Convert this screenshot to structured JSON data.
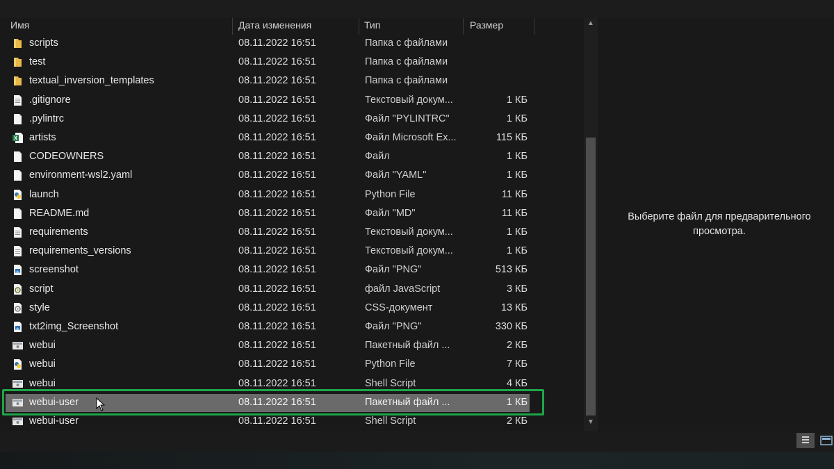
{
  "columns": {
    "name": "Имя",
    "date": "Дата изменения",
    "type": "Тип",
    "size": "Размер"
  },
  "files": [
    {
      "name": "scripts",
      "date": "08.11.2022 16:51",
      "type": "Папка с файлами",
      "size": "",
      "icon": "folder-icon"
    },
    {
      "name": "test",
      "date": "08.11.2022 16:51",
      "type": "Папка с файлами",
      "size": "",
      "icon": "folder-icon"
    },
    {
      "name": "textual_inversion_templates",
      "date": "08.11.2022 16:51",
      "type": "Папка с файлами",
      "size": "",
      "icon": "folder-icon"
    },
    {
      "name": ".gitignore",
      "date": "08.11.2022 16:51",
      "type": "Текстовый докум...",
      "size": "1 КБ",
      "icon": "text-file-icon"
    },
    {
      "name": ".pylintrc",
      "date": "08.11.2022 16:51",
      "type": "Файл \"PYLINTRC\"",
      "size": "1 КБ",
      "icon": "file-icon"
    },
    {
      "name": "artists",
      "date": "08.11.2022 16:51",
      "type": "Файл Microsoft Ex...",
      "size": "115 КБ",
      "icon": "excel-file-icon"
    },
    {
      "name": "CODEOWNERS",
      "date": "08.11.2022 16:51",
      "type": "Файл",
      "size": "1 КБ",
      "icon": "file-icon"
    },
    {
      "name": "environment-wsl2.yaml",
      "date": "08.11.2022 16:51",
      "type": "Файл \"YAML\"",
      "size": "1 КБ",
      "icon": "file-icon"
    },
    {
      "name": "launch",
      "date": "08.11.2022 16:51",
      "type": "Python File",
      "size": "11 КБ",
      "icon": "python-file-icon"
    },
    {
      "name": "README.md",
      "date": "08.11.2022 16:51",
      "type": "Файл \"MD\"",
      "size": "11 КБ",
      "icon": "file-icon"
    },
    {
      "name": "requirements",
      "date": "08.11.2022 16:51",
      "type": "Текстовый докум...",
      "size": "1 КБ",
      "icon": "text-file-icon"
    },
    {
      "name": "requirements_versions",
      "date": "08.11.2022 16:51",
      "type": "Текстовый докум...",
      "size": "1 КБ",
      "icon": "text-file-icon"
    },
    {
      "name": "screenshot",
      "date": "08.11.2022 16:51",
      "type": "Файл \"PNG\"",
      "size": "513 КБ",
      "icon": "image-file-icon"
    },
    {
      "name": "script",
      "date": "08.11.2022 16:51",
      "type": "файл JavaScript",
      "size": "3 КБ",
      "icon": "script-file-icon"
    },
    {
      "name": "style",
      "date": "08.11.2022 16:51",
      "type": "CSS-документ",
      "size": "13 КБ",
      "icon": "css-file-icon"
    },
    {
      "name": "txt2img_Screenshot",
      "date": "08.11.2022 16:51",
      "type": "Файл \"PNG\"",
      "size": "330 КБ",
      "icon": "image-file-icon"
    },
    {
      "name": "webui",
      "date": "08.11.2022 16:51",
      "type": "Пакетный файл ...",
      "size": "2 КБ",
      "icon": "batch-file-icon"
    },
    {
      "name": "webui",
      "date": "08.11.2022 16:51",
      "type": "Python File",
      "size": "7 КБ",
      "icon": "python-file-icon"
    },
    {
      "name": "webui",
      "date": "08.11.2022 16:51",
      "type": "Shell Script",
      "size": "4 КБ",
      "icon": "batch-file-icon"
    },
    {
      "name": "webui-user",
      "date": "08.11.2022 16:51",
      "type": "Пакетный файл ...",
      "size": "1 КБ",
      "icon": "batch-file-icon",
      "selected": true
    },
    {
      "name": "webui-user",
      "date": "08.11.2022 16:51",
      "type": "Shell Script",
      "size": "2 КБ",
      "icon": "batch-file-icon"
    }
  ],
  "preview": {
    "message": "Выберите файл для предварительного просмотра."
  },
  "colors": {
    "background": "#191919",
    "selection": "#6a6a6a",
    "highlight_border": "#1ea64a",
    "folder": "#e8b84a"
  }
}
